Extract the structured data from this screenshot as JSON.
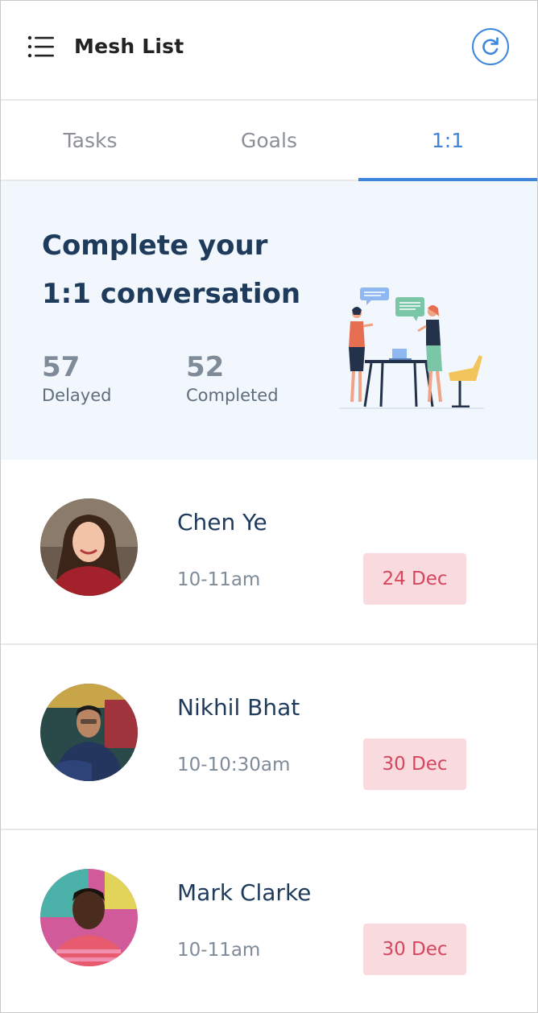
{
  "header": {
    "title": "Mesh List"
  },
  "tabs": [
    {
      "label": "Tasks",
      "active": false
    },
    {
      "label": "Goals",
      "active": false
    },
    {
      "label": "1:1",
      "active": true
    }
  ],
  "hero": {
    "title": "Complete your 1:1 conversation",
    "stats": [
      {
        "value": "57",
        "label": "Delayed"
      },
      {
        "value": "52",
        "label": "Completed"
      }
    ]
  },
  "meetings": [
    {
      "name": "Chen Ye",
      "time": "10-11am",
      "date": "24 Dec"
    },
    {
      "name": "Nikhil Bhat",
      "time": "10-10:30am",
      "date": "30 Dec"
    },
    {
      "name": "Mark Clarke",
      "time": "10-11am",
      "date": "30 Dec"
    }
  ],
  "colors": {
    "accent": "#3d86dc",
    "heading": "#1f3b5c",
    "badge_bg": "#f9dadf",
    "badge_text": "#d4475d",
    "hero_bg": "#f1f7fc"
  },
  "icons": {
    "menu": "menu-list-icon",
    "refresh": "refresh-icon"
  }
}
